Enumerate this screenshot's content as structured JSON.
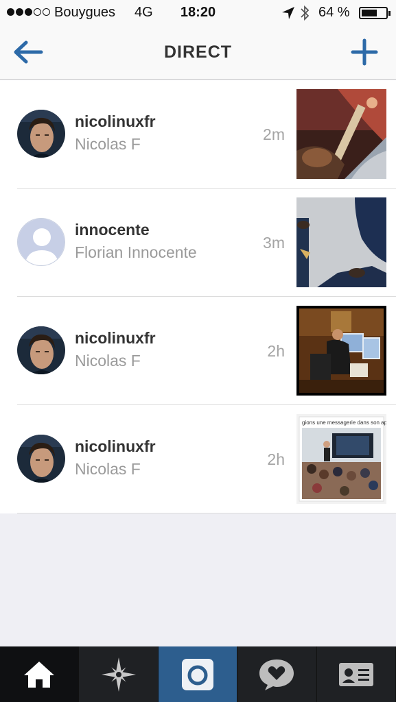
{
  "status_bar": {
    "carrier": "Bouygues",
    "network": "4G",
    "time": "18:20",
    "battery_percent": "64 %",
    "signal_bars": 3,
    "battery_level": 0.64,
    "icons": [
      "location-arrow-icon",
      "bluetooth-icon",
      "battery-icon"
    ]
  },
  "nav": {
    "title": "DIRECT",
    "back_icon": "back-arrow-icon",
    "new_icon": "plus-icon",
    "accent_color": "#2d6aa8"
  },
  "threads": [
    {
      "username": "nicolinuxfr",
      "full_name": "Nicolas F",
      "time": "2m",
      "avatar": "profile-photo",
      "thumbnail": "train-seat-photo"
    },
    {
      "username": "innocente",
      "full_name": "Florian Innocente",
      "time": "3m",
      "avatar": "default-avatar",
      "thumbnail": "floor-shoes-photo"
    },
    {
      "username": "nicolinuxfr",
      "full_name": "Nicolas F",
      "time": "2h",
      "avatar": "profile-photo",
      "thumbnail": "desk-computer-photo"
    },
    {
      "username": "nicolinuxfr",
      "full_name": "Nicolas F",
      "time": "2h",
      "avatar": "profile-photo",
      "thumbnail": "presentation-screenshot"
    }
  ],
  "thumb4_caption": "gions une messagerie dans son appli",
  "tab_bar": {
    "tabs": [
      "home-icon",
      "explore-icon",
      "camera-icon",
      "activity-icon",
      "profile-icon"
    ],
    "active_tab": "home",
    "camera_color": "#2d5e8e"
  }
}
